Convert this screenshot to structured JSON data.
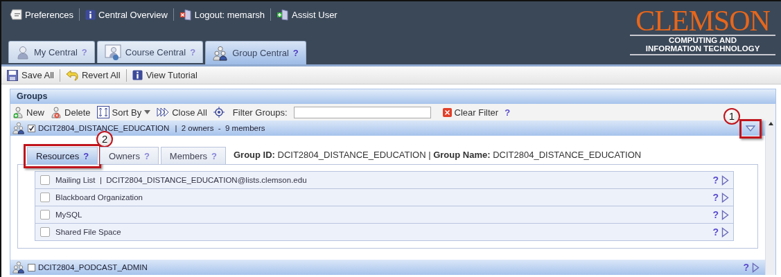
{
  "top_links": [
    {
      "label": "Preferences",
      "kind": "hint"
    },
    {
      "label": "Central Overview",
      "kind": "info"
    },
    {
      "label": "Logout: memarsh",
      "kind": "logout"
    },
    {
      "label": "Assist User",
      "kind": "assist"
    }
  ],
  "logo": {
    "name": "CLEMSON",
    "line_1": "COMPUTING AND",
    "line_2": "INFORMATION TECHNOLOGY"
  },
  "main_tabs": [
    {
      "label": "My Central",
      "help": "?",
      "kind": "person",
      "selected": false
    },
    {
      "label": "Course Central",
      "help": "?",
      "kind": "course",
      "selected": false
    },
    {
      "label": "Group Central",
      "help": "?",
      "kind": "group",
      "selected": true
    }
  ],
  "toolbar": [
    {
      "label": "Save All",
      "kind": "save"
    },
    {
      "label": "Revert All",
      "kind": "revert"
    },
    {
      "label": "View Tutorial",
      "kind": "info"
    }
  ],
  "groups_panel": {
    "title": "Groups",
    "actions": [
      {
        "label": "New",
        "kind": "new"
      },
      {
        "label": "Delete",
        "kind": "delete"
      },
      {
        "label": "Sort By",
        "kind": "sort"
      },
      {
        "label": "Close All",
        "kind": "close-all"
      }
    ],
    "filter": {
      "label": "Filter Groups:"
    },
    "clear_filter": {
      "label": "Clear Filter",
      "help": "?"
    },
    "groups": [
      {
        "name": "DCIT2804_DISTANCE_EDUCATION",
        "summary": "|  2 owners  -  9 members",
        "checked": true,
        "expanded": true,
        "toggle_callout": "1",
        "tabs": [
          {
            "label": "Resources",
            "help": "?",
            "selected": true,
            "callout": "2"
          },
          {
            "label": "Owners",
            "help": "?",
            "selected": false
          },
          {
            "label": "Members",
            "help": "?",
            "selected": false
          }
        ],
        "info": "**Group ID:** DCIT2804_DISTANCE_EDUCATION  |  **Group Name:** DCIT2804_DISTANCE_EDUCATION",
        "resources": [
          {
            "label": "Mailing List  |  DCIT2804_DISTANCE_EDUCATION@lists.clemson.edu",
            "checked": false,
            "help": "?"
          },
          {
            "label": "Blackboard Organization",
            "checked": false,
            "help": "?"
          },
          {
            "label": "MySQL",
            "checked": false,
            "help": "?"
          },
          {
            "label": "Shared File Space",
            "checked": false,
            "help": "?"
          }
        ]
      },
      {
        "name": "DCIT2804_PODCAST_ADMIN",
        "checked": false,
        "expanded": false,
        "help": "?"
      }
    ]
  }
}
